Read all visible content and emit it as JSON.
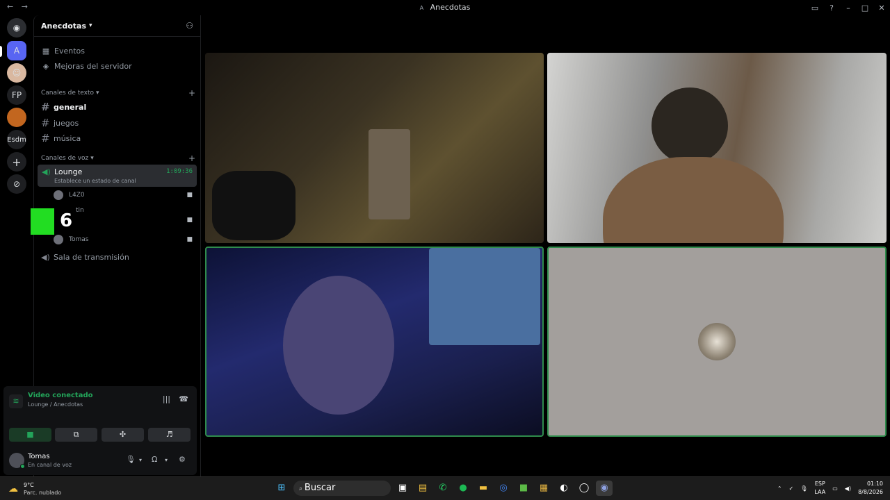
{
  "window": {
    "title": "Anecdotas",
    "server_letter": "A",
    "back_arrow": "←",
    "forward_arrow": "→"
  },
  "server_bar": {
    "items": [
      "A",
      "FP",
      "Esdm"
    ]
  },
  "sidebar": {
    "server_name": "Anecdotas",
    "top_items": [
      {
        "label": "Eventos",
        "icon": "calendar-icon"
      },
      {
        "label": "Mejoras del servidor",
        "icon": "boost-icon"
      }
    ],
    "text_category": "Canales de texto",
    "text_channels": [
      "general",
      "juegos",
      "música"
    ],
    "voice_category": "Canales de voz",
    "voice_channel": {
      "name": "Lounge",
      "timer": "1:09:36",
      "status_placeholder": "Establece un estado de canal"
    },
    "voice_users": [
      "L4Z0",
      "tin",
      "Tomas"
    ],
    "stage_channel": "Sala de transmisión"
  },
  "overlay": {
    "number": "6"
  },
  "voice_panel": {
    "status": "Video conectado",
    "location": "Lounge / Anecdotas"
  },
  "user_panel": {
    "name": "Tomas",
    "status": "En canal de voz"
  },
  "taskbar": {
    "temp": "9°C",
    "weather": "Parc. nublado",
    "search_placeholder": "Buscar",
    "lang": "ESP",
    "lang_sub": "LAA",
    "time": "01:10",
    "date": "8/8/2026"
  },
  "colors": {
    "accent_green": "#23a55a",
    "speaking_border": "#2f8c4c"
  }
}
